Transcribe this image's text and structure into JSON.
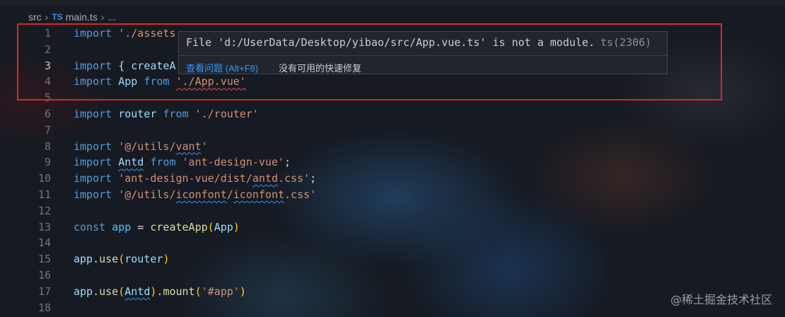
{
  "breadcrumb": {
    "folder": "src",
    "lang_badge": "TS",
    "file": "main.ts",
    "more": "..."
  },
  "lines": [
    {
      "n": "1",
      "tokens": [
        [
          "kw",
          "import"
        ],
        [
          "plain",
          " "
        ],
        [
          "str",
          "'./assets"
        ]
      ]
    },
    {
      "n": "2",
      "tokens": []
    },
    {
      "n": "3",
      "tokens": [
        [
          "kw",
          "import"
        ],
        [
          "plain",
          " { "
        ],
        [
          "id",
          "createA"
        ]
      ]
    },
    {
      "n": "4",
      "tokens": [
        [
          "kw",
          "import"
        ],
        [
          "plain",
          " "
        ],
        [
          "id",
          "App"
        ],
        [
          "plain",
          " "
        ],
        [
          "kw",
          "from"
        ],
        [
          "plain",
          " "
        ],
        [
          "str squig-err",
          "'./App.vue'"
        ]
      ]
    },
    {
      "n": "5",
      "tokens": []
    },
    {
      "n": "6",
      "tokens": [
        [
          "kw",
          "import"
        ],
        [
          "plain",
          " "
        ],
        [
          "id",
          "router"
        ],
        [
          "plain",
          " "
        ],
        [
          "kw",
          "from"
        ],
        [
          "plain",
          " "
        ],
        [
          "str",
          "'./router'"
        ]
      ]
    },
    {
      "n": "7",
      "tokens": []
    },
    {
      "n": "8",
      "tokens": [
        [
          "kw",
          "import"
        ],
        [
          "plain",
          " "
        ],
        [
          "str",
          "'@/utils/"
        ],
        [
          "str squig",
          "vant"
        ],
        [
          "str",
          "'"
        ]
      ]
    },
    {
      "n": "9",
      "tokens": [
        [
          "kw",
          "import"
        ],
        [
          "plain",
          " "
        ],
        [
          "id squig",
          "Antd"
        ],
        [
          "plain",
          " "
        ],
        [
          "kw",
          "from"
        ],
        [
          "plain",
          " "
        ],
        [
          "str",
          "'ant-design-vue'"
        ],
        [
          "plain",
          ";"
        ]
      ]
    },
    {
      "n": "10",
      "tokens": [
        [
          "kw",
          "import"
        ],
        [
          "plain",
          " "
        ],
        [
          "str",
          "'ant-design-vue/dist/"
        ],
        [
          "str squig",
          "antd"
        ],
        [
          "str",
          ".css'"
        ],
        [
          "plain",
          ";"
        ]
      ]
    },
    {
      "n": "11",
      "tokens": [
        [
          "kw",
          "import"
        ],
        [
          "plain",
          " "
        ],
        [
          "str",
          "'@/utils/"
        ],
        [
          "str squig",
          "iconfont"
        ],
        [
          "str",
          "/"
        ],
        [
          "str squig",
          "iconfont"
        ],
        [
          "str",
          ".css'"
        ]
      ]
    },
    {
      "n": "12",
      "tokens": []
    },
    {
      "n": "13",
      "tokens": [
        [
          "kw",
          "const"
        ],
        [
          "plain",
          " "
        ],
        [
          "id2",
          "app"
        ],
        [
          "plain",
          " = "
        ],
        [
          "fn",
          "createApp"
        ],
        [
          "p1",
          "("
        ],
        [
          "id",
          "App"
        ],
        [
          "p1",
          ")"
        ]
      ]
    },
    {
      "n": "14",
      "tokens": []
    },
    {
      "n": "15",
      "tokens": [
        [
          "id",
          "app"
        ],
        [
          "plain",
          "."
        ],
        [
          "fn",
          "use"
        ],
        [
          "p1",
          "("
        ],
        [
          "id",
          "router"
        ],
        [
          "p1",
          ")"
        ]
      ]
    },
    {
      "n": "16",
      "tokens": []
    },
    {
      "n": "17",
      "tokens": [
        [
          "id",
          "app"
        ],
        [
          "plain",
          "."
        ],
        [
          "fn",
          "use"
        ],
        [
          "p1",
          "("
        ],
        [
          "id squig",
          "Antd"
        ],
        [
          "p1",
          ")"
        ],
        [
          "plain",
          "."
        ],
        [
          "fn",
          "mount"
        ],
        [
          "p1",
          "("
        ],
        [
          "str",
          "'#app'"
        ],
        [
          "p1",
          ")"
        ]
      ]
    },
    {
      "n": "18",
      "tokens": []
    }
  ],
  "active_line": "3",
  "hover": {
    "message": "File 'd:/UserData/Desktop/yibao/src/App.vue.ts' is not a module.",
    "code": "ts(2306)",
    "view_problem": "查看问题 (Alt+F8)",
    "no_quick_fix": "没有可用的快速修复"
  },
  "watermark": "@稀土掘金技术社区",
  "colors": {
    "keyword": "#569cd6",
    "string": "#ce9178",
    "identifier": "#9cdcfe",
    "function": "#dcdcaa",
    "error": "#f14c4c",
    "link": "#3794ff",
    "highlight_box": "#e02424"
  }
}
